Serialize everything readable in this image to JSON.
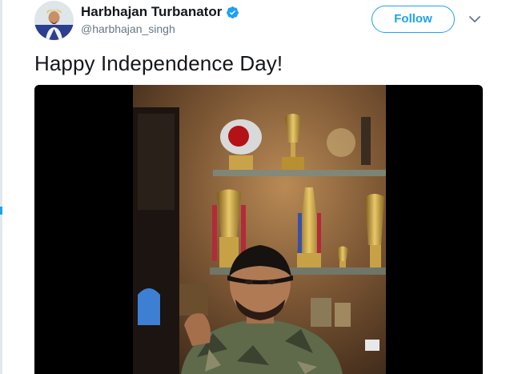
{
  "tweet": {
    "author": {
      "name": "Harbhajan Turbanator",
      "handle": "@harbhajan_singh",
      "verified": true,
      "avatar_icon": "profile-photo"
    },
    "follow_label": "Follow",
    "text": "Happy Independence Day!",
    "media": {
      "type": "video",
      "thumbnail": "man in black turban and camouflage shirt in front of trophy shelves"
    }
  },
  "colors": {
    "accent": "#1da1f2",
    "name_text": "#14171a",
    "secondary_text": "#657786",
    "media_bg": "#000000"
  }
}
